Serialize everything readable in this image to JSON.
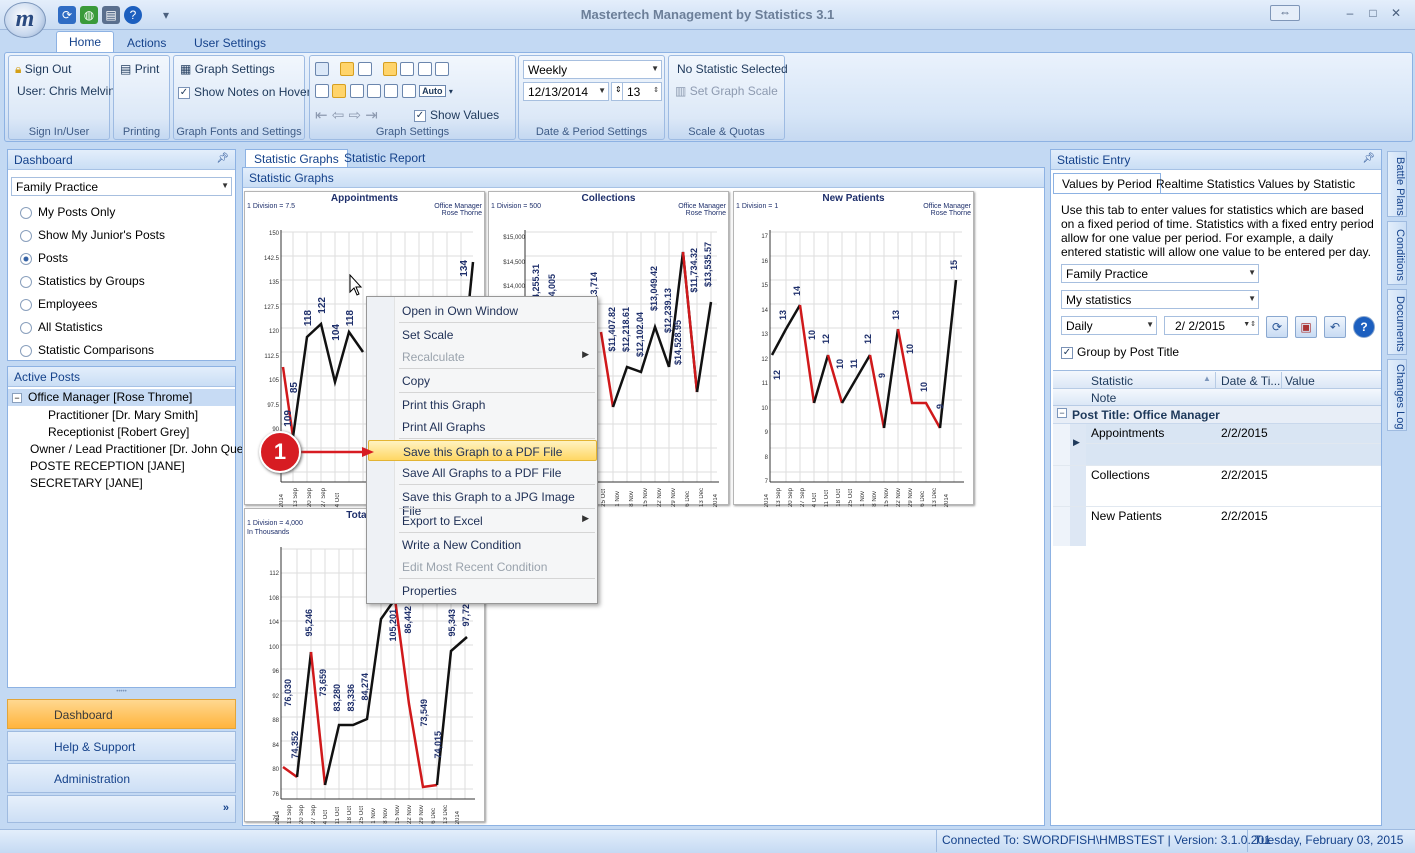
{
  "app": {
    "title": "Mastertech Management by Statistics 3.1",
    "orb_letter": "m"
  },
  "quick_access": {
    "icons": [
      "refresh-icon",
      "globe-icon",
      "printer-icon",
      "help-icon"
    ]
  },
  "ribbon": {
    "tabs": [
      "Home",
      "Actions",
      "User Settings"
    ],
    "active_tab": "Home",
    "signin": {
      "sign_out": "Sign Out",
      "user": "User: Chris Melvin",
      "group_label": "Sign In/User"
    },
    "printing": {
      "print": "Print",
      "group_label": "Printing"
    },
    "fonts": {
      "graph_settings": "Graph Settings",
      "show_notes": "Show Notes on Hover",
      "group_label": "Graph Fonts and Settings"
    },
    "graph_settings": {
      "show_values": "Show Values",
      "auto_label": "Auto",
      "group_label": "Graph Settings"
    },
    "date_period": {
      "period": "Weekly",
      "date": "12/13/2014",
      "count": "13",
      "group_label": "Date & Period Settings"
    },
    "scale": {
      "status": "No Statistic Selected",
      "set_graph_scale": "Set Graph Scale",
      "group_label": "Scale & Quotas"
    }
  },
  "dashboard": {
    "title": "Dashboard",
    "dropdown": "Family Practice",
    "options": [
      "My Posts Only",
      "Show My Junior's Posts",
      "Posts",
      "Statistics by Groups",
      "Employees",
      "All Statistics",
      "Statistic Comparisons"
    ],
    "selected": "Posts"
  },
  "active_posts": {
    "title": "Active Posts",
    "items": [
      {
        "label": "Office Manager [Rose Throme]",
        "level": 0,
        "expander": "−"
      },
      {
        "label": "Practitioner  [Dr. Mary Smith]",
        "level": 1
      },
      {
        "label": "Receptionist  [Robert Grey]",
        "level": 1
      },
      {
        "label": "Owner / Lead Practitioner  [Dr. John Que]",
        "level": 0
      },
      {
        "label": "POSTE RECEPTION [JANE]",
        "level": 0
      },
      {
        "label": "SECRETARY [JANE]",
        "level": 0
      }
    ]
  },
  "nav": {
    "items": [
      "Dashboard",
      "Help & Support",
      "Administration"
    ],
    "active": "Dashboard",
    "grip": "•••••"
  },
  "center": {
    "tabs": [
      "Statistic Graphs",
      "Statistic Report"
    ],
    "header": "Statistic Graphs",
    "graphs": [
      {
        "title": "Appointments",
        "division": "1 Division = 7.5",
        "post": "Office Manager",
        "owner": "Rose Thorne",
        "y_ticks": [
          "150",
          "142.5",
          "135",
          "127.5",
          "120",
          "112.5",
          "105",
          "97.5",
          "90"
        ],
        "labels": [
          "109",
          "85",
          "118",
          "122",
          "104",
          "118",
          "113",
          "134"
        ],
        "x_ticks": [
          "2014",
          "13 Sep",
          "20 Sep",
          "27 Sep",
          "4 Oct",
          "11 Oct",
          "18 Oct",
          "25 Oct"
        ]
      },
      {
        "title": "Collections",
        "division": "1 Division = 500",
        "post": "Office Manager",
        "owner": "Rose Thorne",
        "y_ticks": [
          "$15,000",
          "$14,500",
          "$14,000"
        ],
        "labels": [
          "$14,255.31",
          "$14,005",
          "$13,714",
          "$11,407.82",
          "$12,218.61",
          "$12,102.04",
          "$13,049.42",
          "$12,239.13",
          "$14,528.95",
          "$11,734.32",
          "$13,535.57"
        ],
        "x_ticks": [
          "25 Oct",
          "1 Nov",
          "8 Nov",
          "15 Nov",
          "22 Nov",
          "29 Nov",
          "6 Dec",
          "13 Dec",
          "2014"
        ]
      },
      {
        "title": "New Patients",
        "division": "1 Division = 1",
        "post": "Office Manager",
        "owner": "Rose Thorne",
        "y_ticks": [
          "17",
          "16",
          "15",
          "14",
          "13",
          "12",
          "11",
          "10",
          "9",
          "8",
          "7"
        ],
        "labels": [
          "12",
          "13",
          "14",
          "10",
          "12",
          "10",
          "11",
          "12",
          "9",
          "13",
          "10",
          "10",
          "9",
          "15"
        ],
        "x_ticks": [
          "2014",
          "13 Sep",
          "20 Sep",
          "27 Sep",
          "4 Oct",
          "11 Oct",
          "18 Oct",
          "25 Oct",
          "1 Nov",
          "8 Nov",
          "15 Nov",
          "22 Nov",
          "29 Nov",
          "6 Dec",
          "13 Dec",
          "2014"
        ]
      },
      {
        "title": "Total Pr",
        "division": "1 Division = 4,000",
        "unit": "In Thousands",
        "y_ticks": [
          "112",
          "108",
          "104",
          "100",
          "96",
          "92",
          "88",
          "84",
          "80",
          "76",
          "72"
        ],
        "labels": [
          "76,030",
          "74,352",
          "95,246",
          "73,659",
          "83,280",
          "83,336",
          "84,274",
          "105,201",
          "86,442",
          "73,549",
          "74,015",
          "95,343",
          "97,72"
        ],
        "x_ticks": [
          "2014",
          "13 Sep",
          "20 Sep",
          "27 Sep",
          "4 Oct",
          "11 Oct",
          "18 Oct",
          "25 Oct",
          "1 Nov",
          "8 Nov",
          "15 Nov",
          "22 Nov",
          "29 Nov",
          "6 Dec",
          "13 Dec",
          "2014"
        ]
      }
    ]
  },
  "context_menu": {
    "items": [
      {
        "label": "Open in Own Window"
      },
      {
        "label": "Set Scale"
      },
      {
        "label": "Recalculate",
        "disabled": true,
        "submenu": true
      },
      {
        "label": "Copy"
      },
      {
        "label": "Print this Graph"
      },
      {
        "label": "Print All Graphs"
      },
      {
        "label": "Save this Graph to a PDF File",
        "highlighted": true
      },
      {
        "label": "Save All Graphs to a PDF File"
      },
      {
        "label": "Save this Graph to a JPG Image File"
      },
      {
        "label": "Export to Excel",
        "submenu": true
      },
      {
        "label": "Write a New Condition"
      },
      {
        "label": "Edit Most Recent Condition",
        "disabled": true
      },
      {
        "label": "Properties"
      }
    ],
    "submenu_glyph": "▶"
  },
  "callout": {
    "number": "1"
  },
  "statistic_entry": {
    "title": "Statistic Entry",
    "tabs": [
      "Values by Period",
      "Realtime Statistics",
      "Values by Statistic"
    ],
    "description": "Use this tab to enter values for statistics which are based on a fixed period of time. Statistics with a fixed entry period allow for one value per period. For example, a daily entered statistic will allow one value to be entered per day.",
    "practice": "Family Practice",
    "stat_set": "My statistics",
    "period": "Daily",
    "date": "2/  2/2015",
    "group_by": "Group by Post Title",
    "grid": {
      "headers": [
        "Statistic",
        "Date & Ti...",
        "Value"
      ],
      "note_header": "Note",
      "group_title": "Post Title:  Office Manager",
      "rows": [
        {
          "statistic": "Appointments",
          "date": "2/2/2015",
          "value": ""
        },
        {
          "statistic": "Collections",
          "date": "2/2/2015",
          "value": ""
        },
        {
          "statistic": "New Patients",
          "date": "2/2/2015",
          "value": ""
        }
      ]
    }
  },
  "side_tabs": [
    "Battle Plans",
    "Conditions",
    "Documents",
    "Changes Log"
  ],
  "status_bar": {
    "connection": "Connected To: SWORDFISH\\HMBSTEST | Version: 3.1.0.201",
    "date": "Tuesday, February 03, 2015"
  }
}
